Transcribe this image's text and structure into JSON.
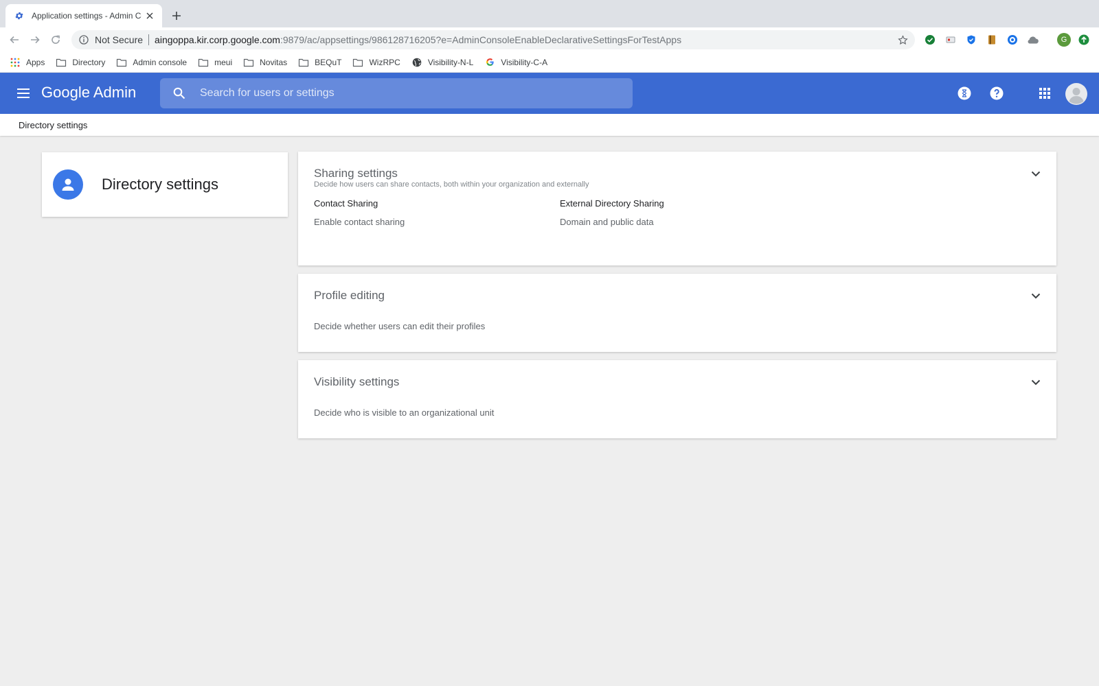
{
  "browser": {
    "tab_title": "Application settings - Admin Co",
    "omnibox": {
      "security_label": "Not Secure",
      "url_host": "aingoppa.kir.corp.google.com",
      "url_rest": ":9879/ac/appsettings/986128716205?e=AdminConsoleEnableDeclarativeSettingsForTestApps"
    },
    "profile_initial": "G",
    "bookmarks": [
      {
        "label": "Apps",
        "icon": "apps-grid-icon"
      },
      {
        "label": "Directory",
        "icon": "folder-icon"
      },
      {
        "label": "Admin console",
        "icon": "folder-icon"
      },
      {
        "label": "meui",
        "icon": "folder-icon"
      },
      {
        "label": "Novitas",
        "icon": "folder-icon"
      },
      {
        "label": "BEQuT",
        "icon": "folder-icon"
      },
      {
        "label": "WizRPC",
        "icon": "folder-icon"
      },
      {
        "label": "Visibility-N-L",
        "icon": "globe-icon"
      },
      {
        "label": "Visibility-C-A",
        "icon": "google-g-icon"
      }
    ]
  },
  "header": {
    "brand_google": "Google",
    "brand_admin": "Admin",
    "search_placeholder": "Search for users or settings",
    "accent_color": "#3b6ad2"
  },
  "breadcrumb": {
    "current": "Directory settings"
  },
  "left_card": {
    "title": "Directory settings",
    "icon": "person-icon"
  },
  "sections": {
    "sharing": {
      "title": "Sharing settings",
      "subtitle": "Decide how users can share contacts, both within your organization and externally",
      "fields": [
        {
          "label": "Contact Sharing",
          "value": "Enable contact sharing"
        },
        {
          "label": "External Directory Sharing",
          "value": "Domain and public data"
        }
      ]
    },
    "profile": {
      "title": "Profile editing",
      "description": "Decide whether users can edit their profiles"
    },
    "visibility": {
      "title": "Visibility settings",
      "description": "Decide who is visible to an organizational unit"
    }
  }
}
